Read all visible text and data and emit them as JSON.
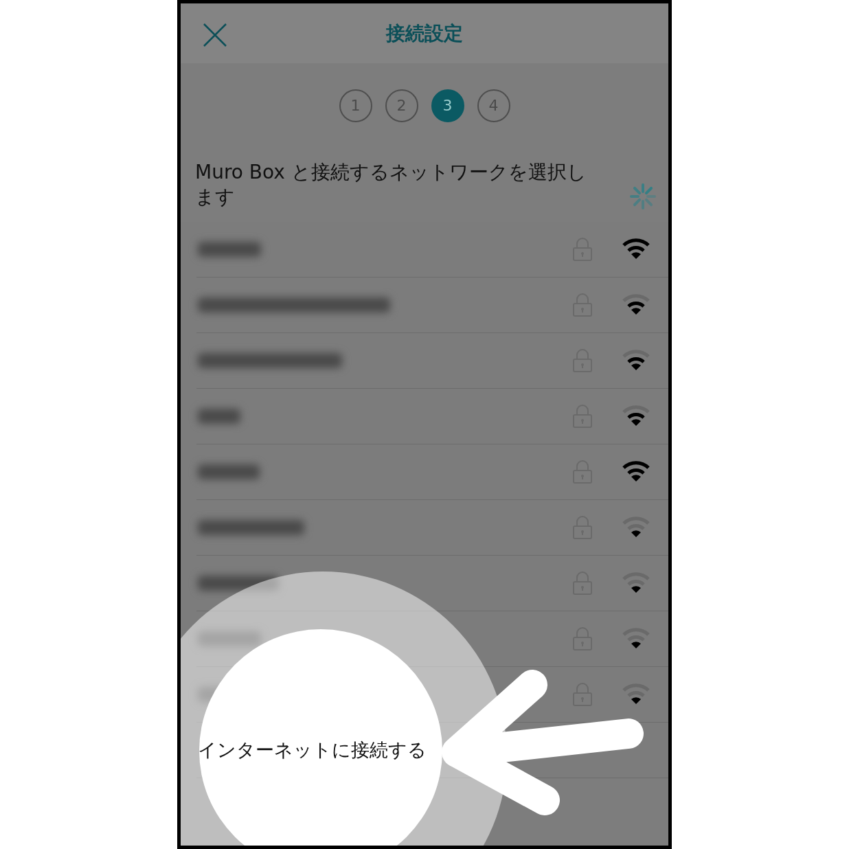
{
  "header": {
    "title": "接続設定"
  },
  "steps": [
    {
      "label": "1",
      "selected": false
    },
    {
      "label": "2",
      "selected": false
    },
    {
      "label": "3",
      "selected": true
    },
    {
      "label": "4",
      "selected": false
    }
  ],
  "instruction": {
    "text": "Muro Box と接続するネットワークを選択します",
    "loading": true
  },
  "networks": [
    {
      "locked": true,
      "kind": "strong"
    },
    {
      "locked": true,
      "kind": "medium"
    },
    {
      "locked": true,
      "kind": "medium"
    },
    {
      "locked": true,
      "kind": "medium"
    },
    {
      "locked": true,
      "kind": "strong"
    },
    {
      "locked": true,
      "kind": "weak"
    },
    {
      "locked": true,
      "kind": "weak"
    },
    {
      "locked": true,
      "kind": "weak"
    },
    {
      "locked": true,
      "kind": "weak"
    }
  ],
  "internet_row": {
    "label": "インターネットに接続する"
  }
}
